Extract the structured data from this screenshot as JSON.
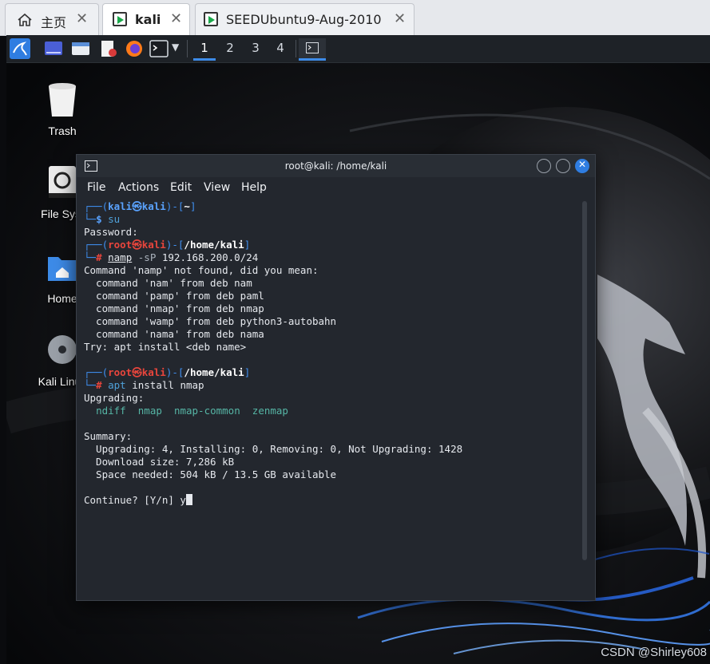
{
  "host_tabs": [
    {
      "label": "主页",
      "icon": "home-icon"
    },
    {
      "label": "kali",
      "icon": "vm-icon",
      "active": true
    },
    {
      "label": "SEEDUbuntu9-Aug-2010",
      "icon": "vm-icon"
    }
  ],
  "panel": {
    "workspaces": [
      "1",
      "2",
      "3",
      "4"
    ],
    "active_workspace": "1"
  },
  "desktop_icons": [
    {
      "label": "Trash",
      "icon": "trash-icon"
    },
    {
      "label": "File Syst",
      "icon": "drive-icon"
    },
    {
      "label": "Home",
      "icon": "home-folder-icon"
    },
    {
      "label": "Kali Linux",
      "icon": "disc-icon"
    }
  ],
  "terminal": {
    "title": "root@kali: /home/kali",
    "menu": [
      "File",
      "Actions",
      "Edit",
      "View",
      "Help"
    ],
    "prompt1": {
      "user": "kali",
      "at": "㉿",
      "host": "kali",
      "dir": "~",
      "sym": "$",
      "cmd": "su"
    },
    "password": "Password:",
    "prompt2": {
      "user": "root",
      "at": "㉿",
      "host": "kali",
      "dir": "/home/kali",
      "sym": "#",
      "cmd": "namp",
      "args": "-sP",
      "rest": "192.168.200.0/24"
    },
    "not_found": "Command 'namp' not found, did you mean:",
    "suggestions": [
      "  command 'nam' from deb nam",
      "  command 'pamp' from deb paml",
      "  command 'nmap' from deb nmap",
      "  command 'wamp' from deb python3-autobahn",
      "  command 'nama' from deb nama"
    ],
    "try_line": "Try: apt install <deb name>",
    "prompt3": {
      "user": "root",
      "at": "㉿",
      "host": "kali",
      "dir": "/home/kali",
      "sym": "#",
      "cmd": "apt",
      "rest": "install nmap"
    },
    "upgrading": "Upgrading:",
    "packages": [
      "ndiff",
      "nmap",
      "nmap-common",
      "zenmap"
    ],
    "summary": "Summary:",
    "summary_lines": [
      "  Upgrading: 4, Installing: 0, Removing: 0, Not Upgrading: 1428",
      "  Download size: 7,286 kB",
      "  Space needed: 504 kB / 13.5 GB available"
    ],
    "continue": "Continue? [Y/n] ",
    "typed": "y"
  },
  "watermark": "CSDN @Shirley608",
  "colors": {
    "accent": "#3d8be8",
    "prompt_red": "#e8453c",
    "prompt_blue": "#3f8ff0"
  }
}
